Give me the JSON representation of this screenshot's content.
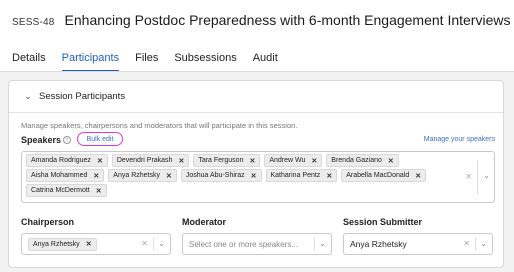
{
  "header": {
    "session_id": "SESS-48",
    "title": "Enhancing Postdoc Preparedness with 6-month Engagement Interviews"
  },
  "tabs": [
    {
      "label": "Details",
      "active": false
    },
    {
      "label": "Participants",
      "active": true
    },
    {
      "label": "Files",
      "active": false
    },
    {
      "label": "Subsessions",
      "active": false
    },
    {
      "label": "Audit",
      "active": false
    }
  ],
  "section": {
    "title": "Session Participants",
    "helper": "Manage speakers, chairpersons and moderators that will participate in this session."
  },
  "speakers": {
    "label": "Speakers",
    "bulk_edit": "Bulk edit",
    "manage_link": "Manage your speakers",
    "chips": [
      "Amanda Rodriguez",
      "Devendri Prakash",
      "Tara Ferguson",
      "Andrew Wu",
      "Brenda Gaziano",
      "Aisha Mohammed",
      "Anya Rzhetsky",
      "Joshua Abu-Shiraz",
      "Katharina Pentz",
      "Arabella MacDonald",
      "Catrina McDermott"
    ]
  },
  "chairperson": {
    "label": "Chairperson",
    "chip": "Anya Rzhetsky"
  },
  "moderator": {
    "label": "Moderator",
    "placeholder": "Select one or more speakers..."
  },
  "submitter": {
    "label": "Session Submitter",
    "value": "Anya Rzhetsky"
  },
  "colors": {
    "accent": "#1f5fbf",
    "link": "#3a6fd0",
    "highlight_ring": "#d63bd6"
  }
}
